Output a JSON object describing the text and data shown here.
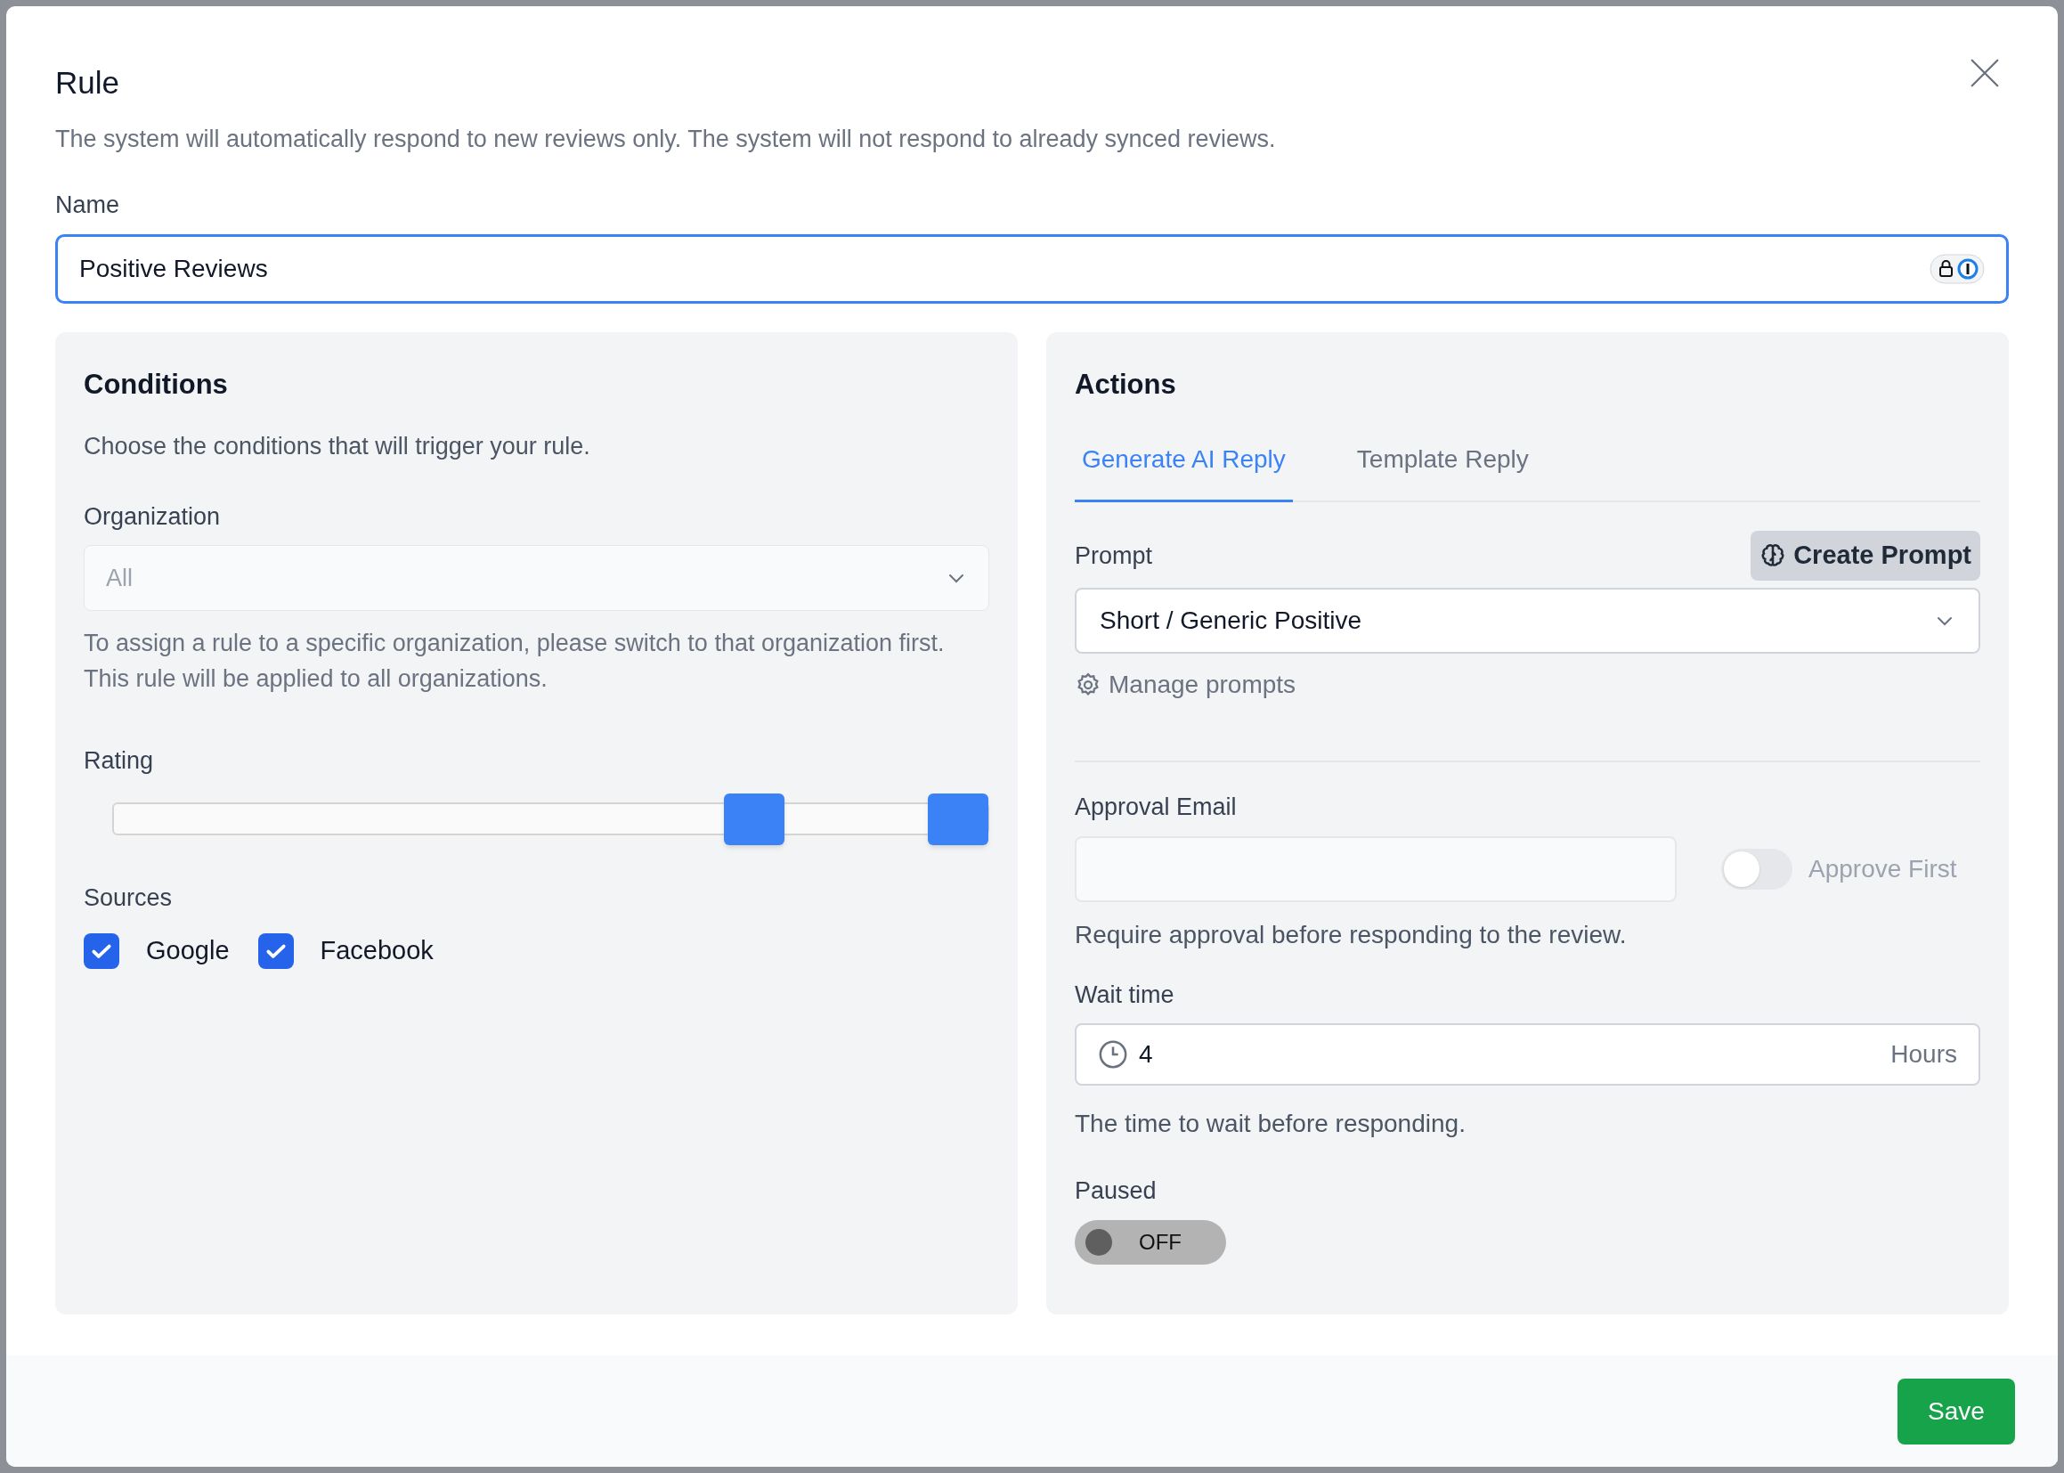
{
  "dialog": {
    "title": "Rule",
    "description": "The system will automatically respond to new reviews only. The system will not respond to already synced reviews."
  },
  "name": {
    "label": "Name",
    "value": "Positive Reviews"
  },
  "conditions": {
    "title": "Conditions",
    "description": "Choose the conditions that will trigger your rule.",
    "organization": {
      "label": "Organization",
      "value": "All",
      "disabled": true,
      "help": "To assign a rule to a specific organization, please switch to that organization first. This rule will be applied to all organizations."
    },
    "rating": {
      "label": "Rating",
      "thumbs": [
        {
          "level": 0.75
        },
        {
          "level": 1
        }
      ]
    },
    "sources": {
      "label": "Sources",
      "items": [
        {
          "label": "Google",
          "checked": true
        },
        {
          "label": "Facebook",
          "checked": true
        }
      ]
    }
  },
  "actions": {
    "title": "Actions",
    "tabs": [
      {
        "label": "Generate AI Reply",
        "selected": true
      },
      {
        "label": "Template Reply",
        "selected": false
      }
    ],
    "prompt": {
      "label": "Prompt",
      "create_button": "Create Prompt",
      "value": "Short / Generic Positive",
      "manage_link": "Manage prompts"
    },
    "approval": {
      "label": "Approval Email",
      "toggle_label": "Approve First",
      "on": false,
      "help": "Require approval before responding to the review."
    },
    "wait_time": {
      "label": "Wait time",
      "value": "4",
      "unit": "Hours",
      "help": "The time to wait before responding."
    },
    "paused": {
      "label": "Paused",
      "on": false,
      "state_text": "OFF"
    }
  },
  "footer": {
    "save": "Save"
  }
}
